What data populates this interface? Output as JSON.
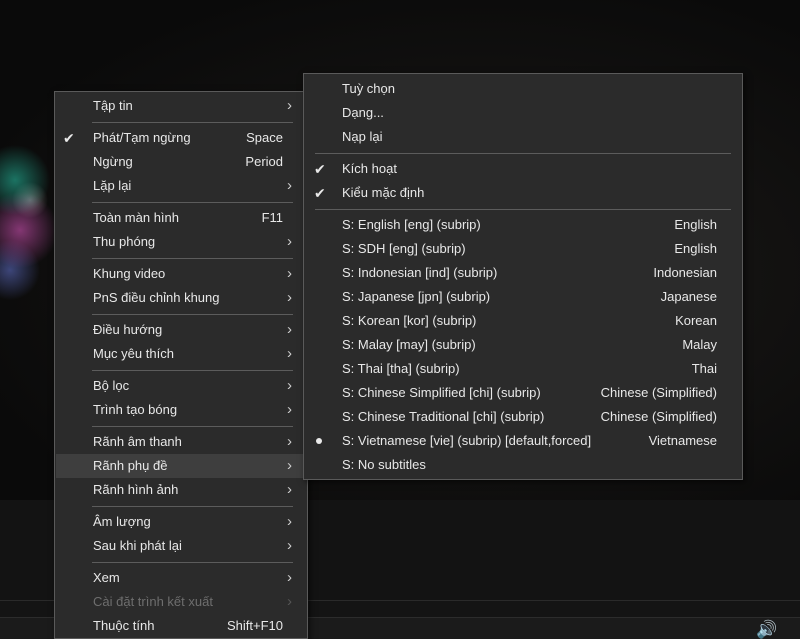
{
  "main_menu": {
    "items": [
      {
        "label": "Tập tin",
        "submenu": true
      },
      {
        "label": "Phát/Tạm ngừng",
        "shortcut": "Space",
        "checked": true
      },
      {
        "label": "Ngừng",
        "shortcut": "Period"
      },
      {
        "label": "Lặp lại",
        "submenu": true
      },
      {
        "label": "Toàn màn hình",
        "shortcut": "F11"
      },
      {
        "label": "Thu phóng",
        "submenu": true
      },
      {
        "label": "Khung video",
        "submenu": true
      },
      {
        "label": "PnS điều chỉnh khung",
        "submenu": true
      },
      {
        "label": "Điều hướng",
        "submenu": true
      },
      {
        "label": "Mục yêu thích",
        "submenu": true
      },
      {
        "label": "Bộ lọc",
        "submenu": true
      },
      {
        "label": "Trình tạo bóng",
        "submenu": true
      },
      {
        "label": "Rãnh âm thanh",
        "submenu": true
      },
      {
        "label": "Rãnh phụ đề",
        "submenu": true,
        "highlighted": true
      },
      {
        "label": "Rãnh hình ảnh",
        "submenu": true
      },
      {
        "label": "Âm lượng",
        "submenu": true
      },
      {
        "label": "Sau khi phát lại",
        "submenu": true
      },
      {
        "label": "Xem",
        "submenu": true
      },
      {
        "label": "Cài đặt trình kết xuất",
        "submenu": true,
        "disabled": true
      },
      {
        "label": "Thuộc tính",
        "shortcut": "Shift+F10"
      }
    ]
  },
  "subtitle_menu": {
    "options": [
      {
        "label": "Tuỳ chọn"
      },
      {
        "label": "Dạng..."
      },
      {
        "label": "Nạp lại"
      },
      {
        "label": "Kích hoạt",
        "checked": true
      },
      {
        "label": "Kiểu mặc định",
        "checked": true
      }
    ],
    "tracks": [
      {
        "label": "S: English [eng] (subrip)",
        "language": "English"
      },
      {
        "label": "S: SDH [eng] (subrip)",
        "language": "English"
      },
      {
        "label": "S: Indonesian [ind] (subrip)",
        "language": "Indonesian"
      },
      {
        "label": "S: Japanese [jpn] (subrip)",
        "language": "Japanese"
      },
      {
        "label": "S: Korean [kor] (subrip)",
        "language": "Korean"
      },
      {
        "label": "S: Malay [may] (subrip)",
        "language": "Malay"
      },
      {
        "label": "S: Thai [tha] (subrip)",
        "language": "Thai"
      },
      {
        "label": "S: Chinese Simplified [chi] (subrip)",
        "language": "Chinese (Simplified)"
      },
      {
        "label": "S: Chinese Traditional [chi] (subrip)",
        "language": "Chinese (Simplified)"
      },
      {
        "label": "S: Vietnamese [vie] (subrip) [default,forced]",
        "language": "Vietnamese",
        "selected": true
      },
      {
        "label": "S: No subtitles",
        "language": ""
      }
    ]
  },
  "icons": {
    "check": "✔",
    "arrow": "›",
    "volume": "🔊"
  }
}
